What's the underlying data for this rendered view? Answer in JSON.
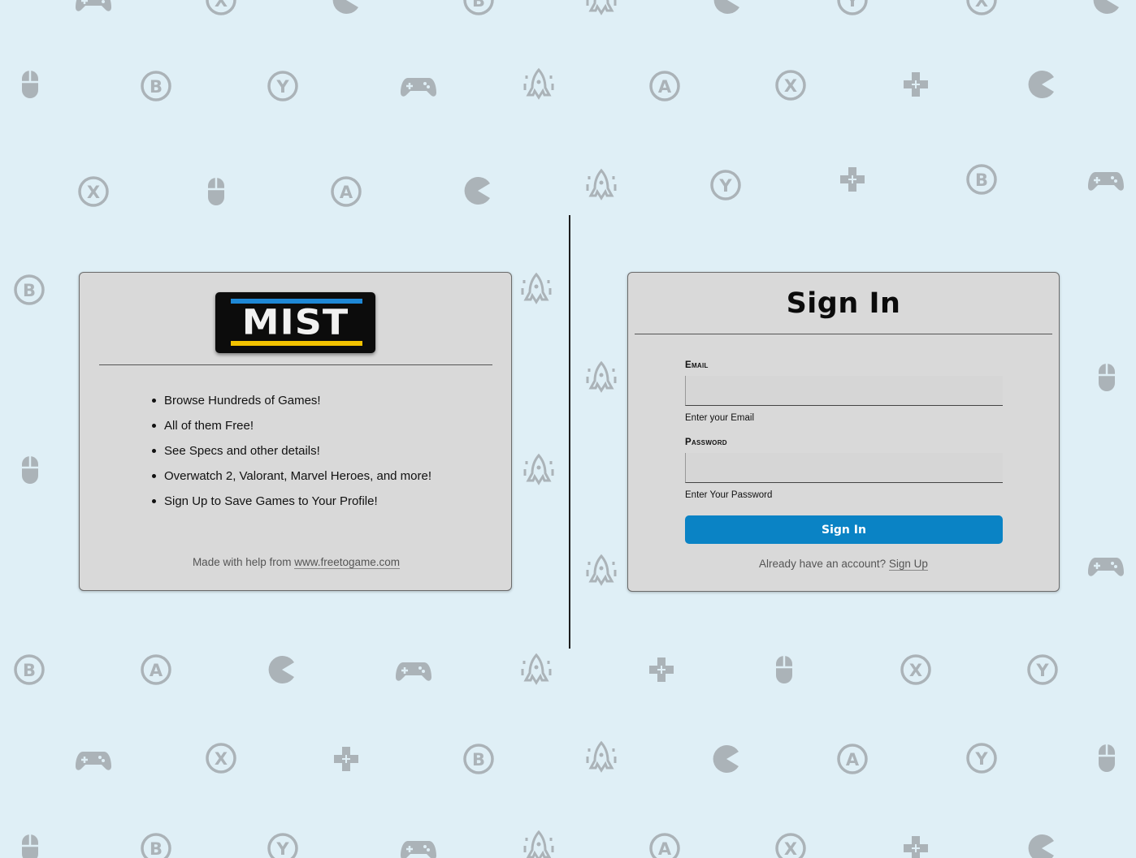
{
  "brand": {
    "logo_text": "MIST",
    "colors": {
      "blue": "#1e88d6",
      "yellow": "#f2c200",
      "dark": "#0c0c0c"
    }
  },
  "info": {
    "features": [
      "Browse Hundreds of Games!",
      "All of them Free!",
      "See Specs and other details!",
      "Overwatch 2, Valorant, Marvel Heroes, and more!",
      "Sign Up to Save Games to Your Profile!"
    ],
    "credit_prefix": "Made with help from ",
    "credit_link": "www.freetogame.com"
  },
  "signin": {
    "title": "Sign In",
    "email_label": "Email",
    "email_help": "Enter your Email",
    "password_label": "Password",
    "password_help": "Enter Your Password",
    "button_label": "Sign In",
    "account_prompt": "Already have an account? ",
    "account_link": "Sign Up",
    "accent_color": "#0a83c5"
  },
  "background": {
    "pattern_icons": [
      "gamepad-icon",
      "mouse-icon",
      "b-button-icon",
      "y-button-icon",
      "a-button-icon",
      "x-button-icon",
      "dpad-icon",
      "pacman-icon",
      "space-invader-icon"
    ],
    "icon_color": "#a9b0b5"
  }
}
